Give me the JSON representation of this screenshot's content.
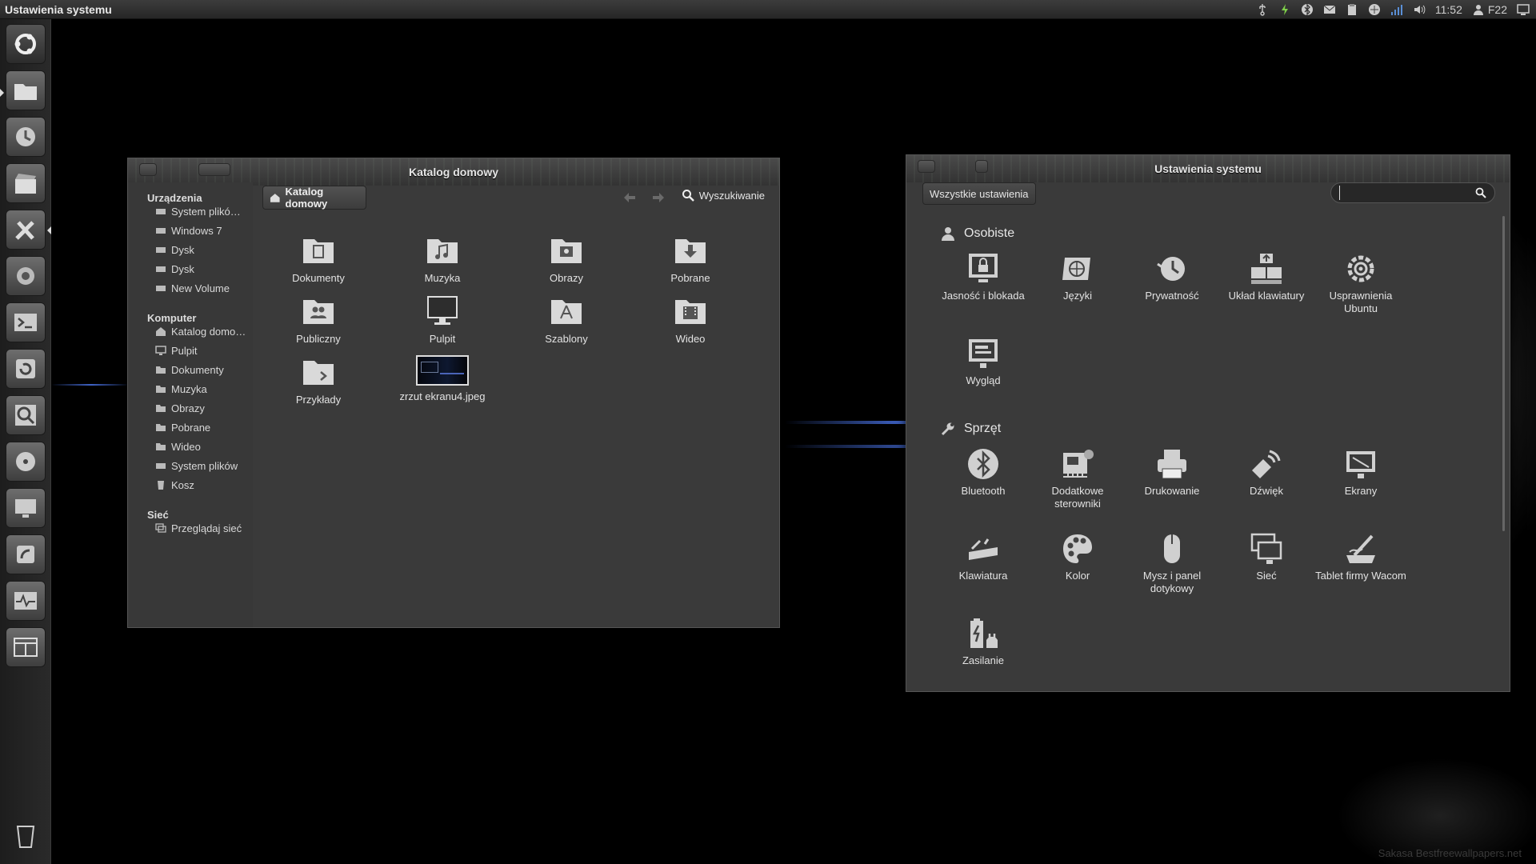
{
  "top_panel": {
    "title": "Ustawienia systemu",
    "time": "11:52",
    "user": "F22",
    "indicators": [
      "usb-icon",
      "power-icon",
      "bluetooth-indicator-icon",
      "mail-icon",
      "clipboard-icon",
      "network-icon",
      "signal-icon",
      "volume-icon",
      "user-icon",
      "session-icon"
    ]
  },
  "launcher": {
    "items": [
      "ubuntu-dash",
      "files",
      "system-update",
      "media-video",
      "system-settings",
      "tweak-tool",
      "terminal",
      "backup",
      "disk-usage",
      "disks",
      "display-settings",
      "startup",
      "system-monitor",
      "workspaces",
      "trash"
    ]
  },
  "file_manager": {
    "title": "Katalog domowy",
    "path_tab": "Katalog domowy",
    "search_label": "Wyszukiwanie",
    "sidebar": {
      "devices_header": "Urządzenia",
      "devices": [
        "System plikó…",
        "Windows 7",
        "Dysk",
        "Dysk",
        "New Volume"
      ],
      "computer_header": "Komputer",
      "computer": [
        "Katalog domo…",
        "Pulpit",
        "Dokumenty",
        "Muzyka",
        "Obrazy",
        "Pobrane",
        "Wideo",
        "System plików",
        "Kosz"
      ],
      "network_header": "Sieć",
      "network": [
        "Przeglądaj sieć"
      ]
    },
    "items": [
      {
        "label": "Dokumenty",
        "icon": "documents-folder-icon"
      },
      {
        "label": "Muzyka",
        "icon": "music-folder-icon"
      },
      {
        "label": "Obrazy",
        "icon": "pictures-folder-icon"
      },
      {
        "label": "Pobrane",
        "icon": "downloads-folder-icon"
      },
      {
        "label": "Publiczny",
        "icon": "public-folder-icon"
      },
      {
        "label": "Pulpit",
        "icon": "desktop-folder-icon"
      },
      {
        "label": "Szablony",
        "icon": "templates-folder-icon"
      },
      {
        "label": "Wideo",
        "icon": "videos-folder-icon"
      },
      {
        "label": "Przykłady",
        "icon": "examples-folder-icon"
      },
      {
        "label": "zrzut ekranu4.jpeg",
        "icon": "image-thumbnail"
      }
    ]
  },
  "settings": {
    "title": "Ustawienia systemu",
    "all_settings_label": "Wszystkie ustawienia",
    "search_value": "",
    "sections": [
      {
        "name": "Osobiste",
        "items": [
          {
            "label": "Jasność i blokada",
            "icon": "brightness-lock-icon"
          },
          {
            "label": "Języki",
            "icon": "languages-icon"
          },
          {
            "label": "Prywatność",
            "icon": "privacy-icon"
          },
          {
            "label": "Układ klawiatury",
            "icon": "keyboard-layout-icon"
          },
          {
            "label": "Usprawnienia Ubuntu",
            "icon": "ubuntu-tweaks-icon"
          },
          {
            "label": "Wygląd",
            "icon": "appearance-icon"
          }
        ]
      },
      {
        "name": "Sprzęt",
        "items": [
          {
            "label": "Bluetooth",
            "icon": "bluetooth-icon"
          },
          {
            "label": "Dodatkowe sterowniki",
            "icon": "drivers-icon"
          },
          {
            "label": "Drukowanie",
            "icon": "printer-icon"
          },
          {
            "label": "Dźwięk",
            "icon": "sound-icon"
          },
          {
            "label": "Ekrany",
            "icon": "displays-icon"
          },
          {
            "label": "Klawiatura",
            "icon": "keyboard-icon"
          },
          {
            "label": "Kolor",
            "icon": "color-icon"
          },
          {
            "label": "Mysz i panel dotykowy",
            "icon": "mouse-icon"
          },
          {
            "label": "Sieć",
            "icon": "network-icon"
          },
          {
            "label": "Tablet firmy Wacom",
            "icon": "wacom-icon"
          },
          {
            "label": "Zasilanie",
            "icon": "power-icon"
          }
        ]
      }
    ]
  },
  "wallpaper_credit": "Sakasa Bestfreewallpapers.net"
}
